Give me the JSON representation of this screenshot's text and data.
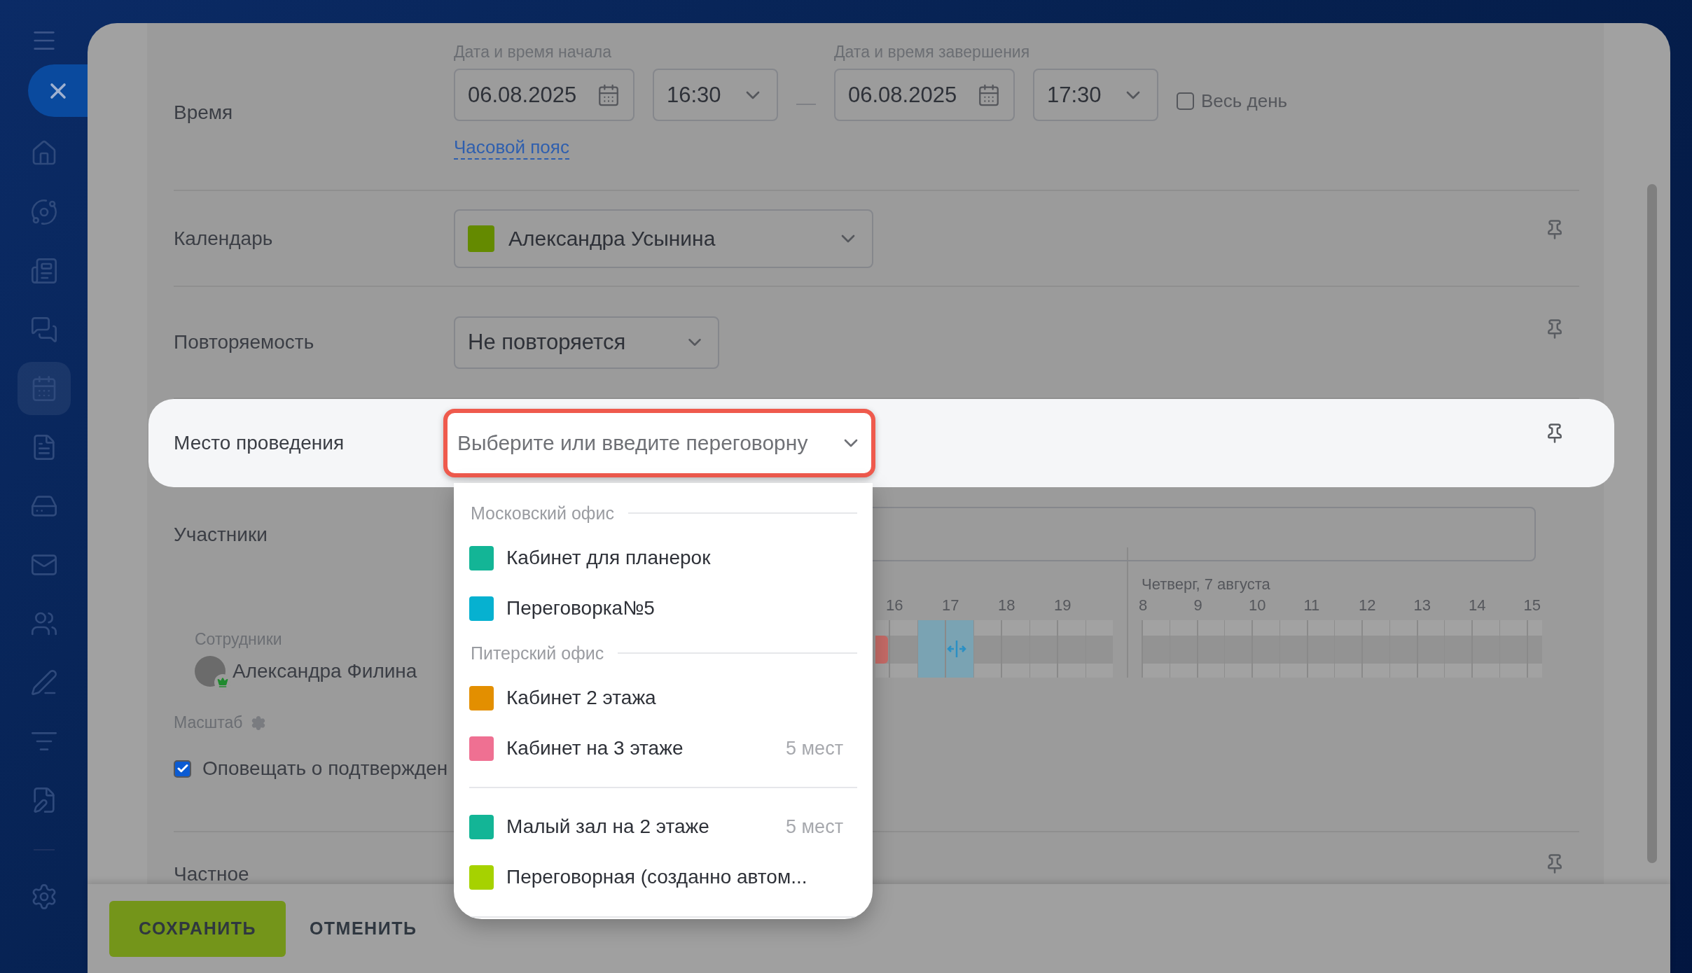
{
  "sidebar": {
    "items": [
      {
        "selected": false
      },
      {
        "selected": false
      },
      {
        "selected": false
      },
      {
        "selected": false
      },
      {
        "selected": true
      },
      {
        "selected": false
      },
      {
        "selected": false
      },
      {
        "selected": false
      },
      {
        "selected": false
      },
      {
        "selected": false
      },
      {
        "selected": false
      },
      {
        "selected": false
      },
      {
        "selected": false
      }
    ]
  },
  "form": {
    "time": {
      "label": "Время",
      "start_label": "Дата и время начала",
      "start_date": "06.08.2025",
      "start_time": "16:30",
      "dash": "—",
      "end_label": "Дата и время завершения",
      "end_date": "06.08.2025",
      "end_time": "17:30",
      "all_day": {
        "label": "Весь день",
        "checked": false
      },
      "timezone_link": "Часовой пояс"
    },
    "calendar": {
      "label": "Календарь",
      "value": "Александра Усынина",
      "color": "#648a00"
    },
    "repeat": {
      "label": "Повторяемость",
      "value": "Не повторяется"
    },
    "location": {
      "label": "Место проведения",
      "placeholder": "Выберите или введите переговорну"
    },
    "participants": {
      "label": "Участники",
      "employees_label": "Сотрудники",
      "employee": "Александра Филина",
      "scale_label": "Масштаб",
      "day_label": "Четверг, 7 августа",
      "hours_before": [
        "16",
        "17",
        "18",
        "19"
      ],
      "hours": [
        "8",
        "9",
        "10",
        "11",
        "12",
        "13",
        "14",
        "15"
      ]
    },
    "notify": {
      "label": "Оповещать о подтвержден",
      "checked": true
    },
    "private": {
      "label": "Частное"
    }
  },
  "room_dropdown": {
    "groups": [
      {
        "title": "Московский офис",
        "rooms": [
          {
            "name": "Кабинет для планерок",
            "color": "#13b596"
          },
          {
            "name": "Переговорка№5",
            "color": "#06b1d0"
          }
        ]
      },
      {
        "title": "Питерский офис",
        "rooms": [
          {
            "name": "Кабинет 2 этажа",
            "color": "#e38f00"
          },
          {
            "name": "Кабинет на 3 этаже",
            "color": "#ef7092",
            "capacity": "5 мест"
          }
        ]
      },
      {
        "rooms": [
          {
            "name": "Малый зал на 2 этаже",
            "color": "#13b596",
            "capacity": "5 мест"
          },
          {
            "name": "Переговорная (созданно автом...",
            "color": "#a6d200"
          }
        ]
      }
    ]
  },
  "footer": {
    "buttons": [
      {
        "label": "СОХРАНИТЬ",
        "kind": "primary"
      },
      {
        "label": "ОТМЕНИТЬ",
        "kind": "link"
      }
    ]
  }
}
